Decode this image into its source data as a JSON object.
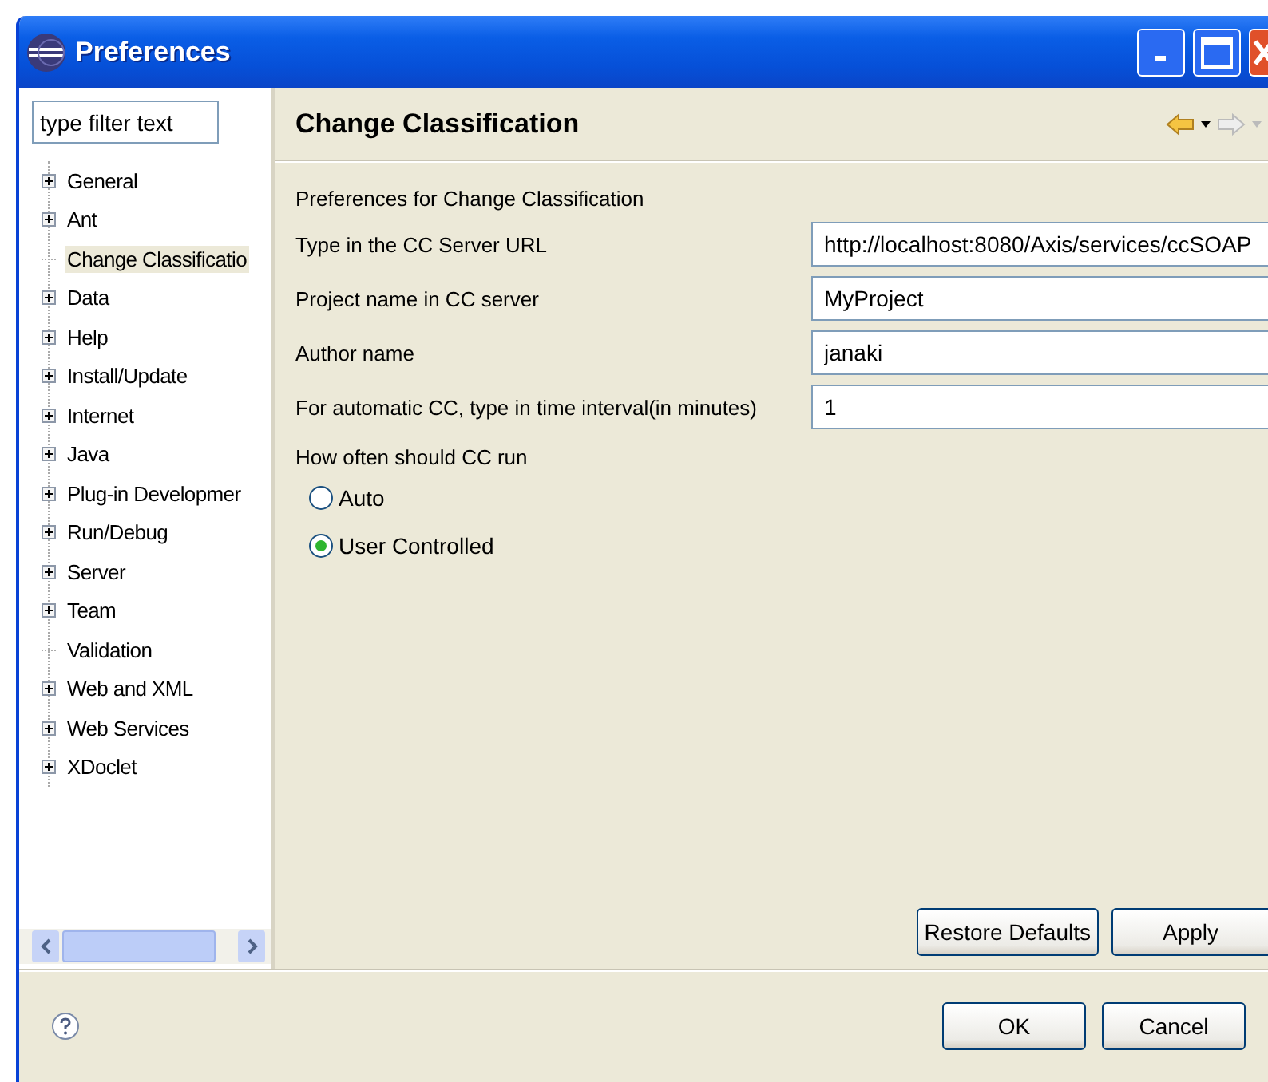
{
  "window": {
    "title": "Preferences"
  },
  "filter": {
    "placeholder": "type filter text"
  },
  "tree": [
    {
      "label": "General",
      "expandable": true,
      "selected": false
    },
    {
      "label": "Ant",
      "expandable": true,
      "selected": false
    },
    {
      "label": "Change Classificatio",
      "expandable": false,
      "selected": true
    },
    {
      "label": "Data",
      "expandable": true,
      "selected": false
    },
    {
      "label": "Help",
      "expandable": true,
      "selected": false
    },
    {
      "label": "Install/Update",
      "expandable": true,
      "selected": false
    },
    {
      "label": "Internet",
      "expandable": true,
      "selected": false
    },
    {
      "label": "Java",
      "expandable": true,
      "selected": false
    },
    {
      "label": "Plug-in Developmer",
      "expandable": true,
      "selected": false
    },
    {
      "label": "Run/Debug",
      "expandable": true,
      "selected": false
    },
    {
      "label": "Server",
      "expandable": true,
      "selected": false
    },
    {
      "label": "Team",
      "expandable": true,
      "selected": false
    },
    {
      "label": "Validation",
      "expandable": false,
      "selected": false
    },
    {
      "label": "Web and XML",
      "expandable": true,
      "selected": false
    },
    {
      "label": "Web Services",
      "expandable": true,
      "selected": false
    },
    {
      "label": "XDoclet",
      "expandable": true,
      "selected": false
    }
  ],
  "page": {
    "title": "Change Classification",
    "description": "Preferences for Change Classification",
    "fields": [
      {
        "label": "Type in the CC Server URL",
        "value": "http://localhost:8080/Axis/services/ccSOAP"
      },
      {
        "label": "Project name in CC server",
        "value": "MyProject"
      },
      {
        "label": "Author name",
        "value": "janaki"
      },
      {
        "label": "For automatic CC, type in time interval(in minutes)",
        "value": "1"
      }
    ],
    "run_group": {
      "label": "How often should CC run",
      "options": [
        {
          "label": "Auto",
          "selected": false
        },
        {
          "label": "User Controlled",
          "selected": true
        }
      ]
    },
    "buttons": [
      "Restore Defaults",
      "Apply"
    ]
  },
  "dialog_buttons": [
    "OK",
    "Cancel"
  ]
}
